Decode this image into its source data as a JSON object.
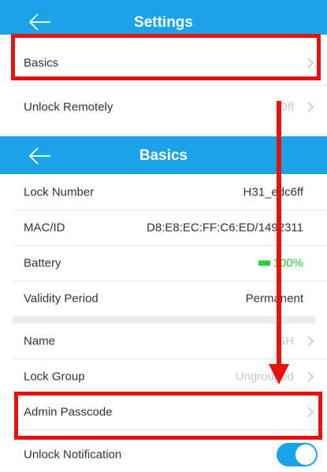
{
  "settings": {
    "title": "Settings",
    "rows": [
      {
        "label": "Basics",
        "value": ""
      },
      {
        "label": "Unlock Remotely",
        "value": "Off"
      }
    ]
  },
  "basics": {
    "title": "Basics",
    "info": [
      {
        "label": "Lock Number",
        "value": "H31_edc6ff"
      },
      {
        "label": "MAC/ID",
        "value": "D8:E8:EC:FF:C6:ED/1492311"
      },
      {
        "label": "Battery",
        "value": "100%"
      },
      {
        "label": "Validity Period",
        "value": "Permanent"
      }
    ],
    "settings": [
      {
        "label": "Name",
        "value": "GH"
      },
      {
        "label": "Lock Group",
        "value": "Ungrouped"
      },
      {
        "label": "Admin Passcode",
        "value": ""
      },
      {
        "label": "Unlock Notification",
        "toggle_on": true
      }
    ]
  },
  "colors": {
    "header": "#1aa3e8",
    "highlight": "#e8120c",
    "battery": "#2ecc40"
  }
}
